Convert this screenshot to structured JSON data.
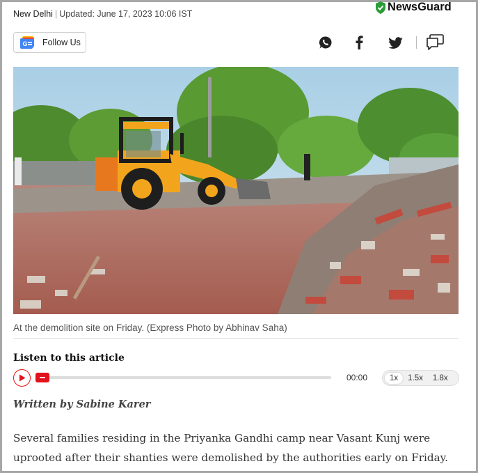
{
  "meta": {
    "location": "New Delhi",
    "updated": "Updated: June 17, 2023 10:06 IST"
  },
  "newsguard": {
    "label": "NewsGuard",
    "icon": "shield-check-icon",
    "color": "#2a9d38"
  },
  "follow": {
    "label": "Follow Us",
    "icon": "google-news-icon"
  },
  "share": {
    "icons": [
      "whatsapp-icon",
      "facebook-icon",
      "twitter-icon",
      "comment-icon"
    ]
  },
  "photo": {
    "caption": "At the demolition site on Friday. (Express Photo by Abhinav Saha)"
  },
  "audio": {
    "heading": "Listen to this article",
    "time": "00:00",
    "speeds": [
      "1x",
      "1.5x",
      "1.8x"
    ],
    "selected_speed": "1x",
    "progress": 0,
    "accent": "#e3111b"
  },
  "article": {
    "byline": "Written by Sabine Karer",
    "paragraph": "Several families residing in the Priyanka Gandhi camp near Vasant Kunj were uprooted after their shanties were demolished by the authorities early on Friday."
  }
}
